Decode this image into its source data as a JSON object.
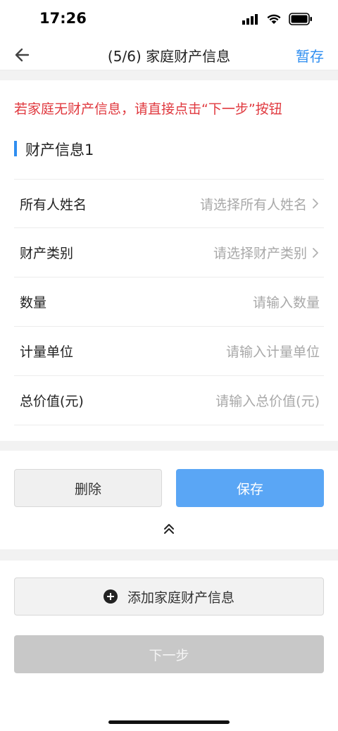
{
  "status_bar": {
    "time": "17:26"
  },
  "nav": {
    "title": "(5/6) 家庭财产信息",
    "save_label": "暂存"
  },
  "notice": "若家庭无财产信息，请直接点击“下一步”按钮",
  "section_title": "财产信息1",
  "form": {
    "owner_name": {
      "label": "所有人姓名",
      "placeholder": "请选择所有人姓名"
    },
    "property_type": {
      "label": "财产类别",
      "placeholder": "请选择财产类别"
    },
    "quantity": {
      "label": "数量",
      "placeholder": "请输入数量"
    },
    "unit": {
      "label": "计量单位",
      "placeholder": "请输入计量单位"
    },
    "total_value": {
      "label": "总价值(元)",
      "placeholder": "请输入总价值(元)"
    }
  },
  "buttons": {
    "delete": "删除",
    "save": "保存",
    "add": "添加家庭财产信息",
    "next": "下一步"
  },
  "colors": {
    "accent": "#2f8ef0",
    "notice_red": "#e0383e",
    "save_button": "#5aa6f5",
    "disabled_button": "#c8c8c8"
  }
}
